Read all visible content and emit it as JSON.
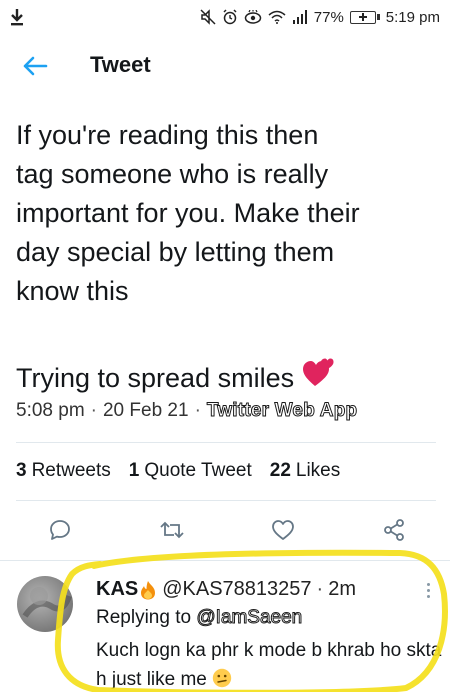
{
  "status_bar": {
    "battery_percent": "77%",
    "time": "5:19 pm"
  },
  "header": {
    "title": "Tweet"
  },
  "tweet": {
    "text": "If you're reading this then\ntag someone who is really\nimportant for you. Make their\nday special by letting them\nknow this",
    "extra_text": "Trying to spread smiles",
    "time": "5:08 pm",
    "date": "20 Feb 21",
    "source": "Twitter Web App",
    "dot": "·",
    "stats": {
      "retweets_count": "3",
      "retweets_label": "Retweets",
      "quotes_count": "1",
      "quotes_label": "Quote Tweet",
      "likes_count": "22",
      "likes_label": "Likes"
    }
  },
  "reply": {
    "name": "KAS",
    "handle": "@KAS78813257",
    "dot": "·",
    "time": "2m",
    "replying_prefix": "Replying to",
    "replying_to": "@IamSaeen",
    "text": "Kuch logn ka phr k mode b khrab ho skta h just like me"
  },
  "colors": {
    "accent": "#1da1f2",
    "icon_gray": "#657786",
    "highlight": "#f4e01c",
    "heart_emoji": "#e0245e"
  }
}
